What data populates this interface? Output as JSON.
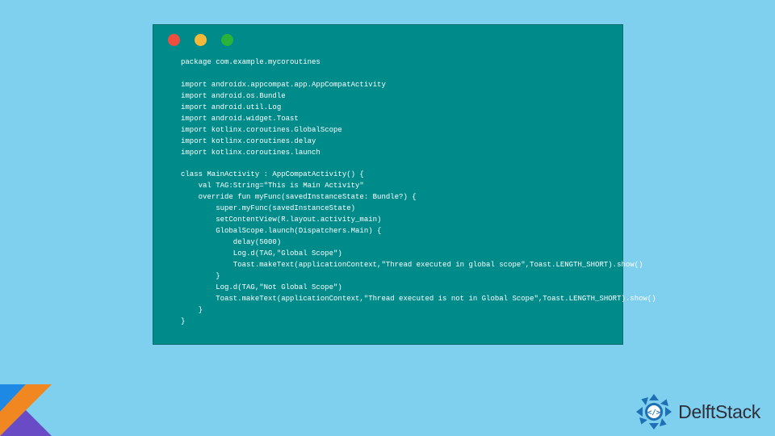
{
  "window": {
    "dots": [
      "red",
      "yellow",
      "green"
    ]
  },
  "code": {
    "lines": [
      "package com.example.mycoroutines",
      "",
      "import androidx.appcompat.app.AppCompatActivity",
      "import android.os.Bundle",
      "import android.util.Log",
      "import android.widget.Toast",
      "import kotlinx.coroutines.GlobalScope",
      "import kotlinx.coroutines.delay",
      "import kotlinx.coroutines.launch",
      "",
      "class MainActivity : AppCompatActivity() {",
      "    val TAG:String=\"This is Main Activity\"",
      "    override fun myFunc(savedInstanceState: Bundle?) {",
      "        super.myFunc(savedInstanceState)",
      "        setContentView(R.layout.activity_main)",
      "        GlobalScope.launch(Dispatchers.Main) {",
      "            delay(5000)",
      "            Log.d(TAG,\"Global Scope\")",
      "            Toast.makeText(applicationContext,\"Thread executed in global scope\",Toast.LENGTH_SHORT).show()",
      "        }",
      "        Log.d(TAG,\"Not Global Scope\")",
      "        Toast.makeText(applicationContext,\"Thread executed is not in Global Scope\",Toast.LENGTH_SHORT).show()",
      "    }",
      "}"
    ]
  },
  "brand": {
    "name": "DelftStack"
  },
  "colors": {
    "page_bg": "#7fcfee",
    "window_bg": "#008b8b",
    "dot_red": "#ee4e3e",
    "dot_yellow": "#f5b83a",
    "dot_green": "#29b33b",
    "kotlin_purple": "#6a4bc6",
    "kotlin_orange": "#f08720",
    "brand_blue": "#1e6fb4"
  }
}
